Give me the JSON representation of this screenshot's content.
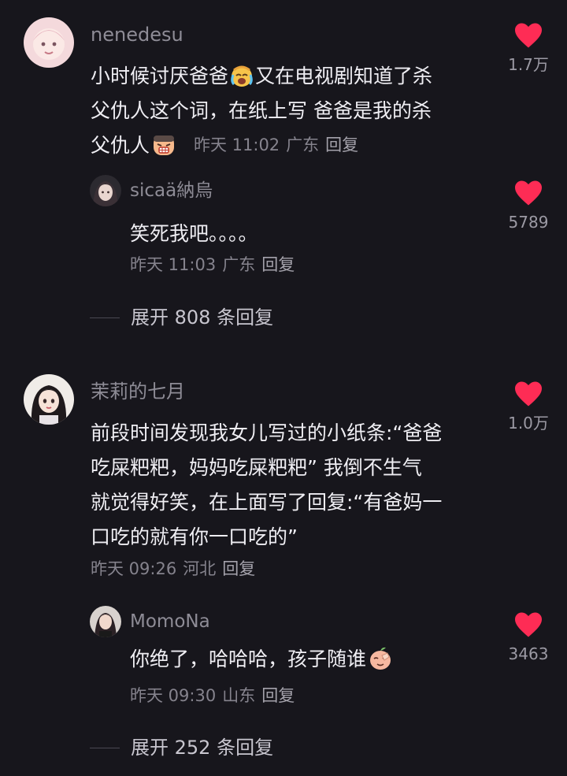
{
  "comments": [
    {
      "username": "nenedesu",
      "text_lines": [
        "小时候讨厌爸爸",
        "又在电视剧知道了杀",
        "父仇人这个词，在纸上写 爸爸是我的杀",
        "父仇人"
      ],
      "emoji": [
        "crying-face-emoji",
        "frustrated-face-emoji"
      ],
      "time": "昨天 11:02",
      "location": "广东",
      "reply_label": "回复",
      "likes": "1.7万",
      "reply": {
        "username": "sicaä納烏",
        "text": "笑死我吧。。。。",
        "time": "昨天 11:03",
        "location": "广东",
        "reply_label": "回复",
        "likes": "5789"
      },
      "expand_label": "展开 808 条回复"
    },
    {
      "username": "茉莉的七月",
      "text_lines": [
        "前段时间发现我女儿写过的小纸条:“爸爸",
        "吃屎粑粑，妈妈吃屎粑粑” 我倒不生气",
        "就觉得好笑，在上面写了回复:“有爸妈一",
        "口吃的就有你一口吃的”"
      ],
      "time": "昨天 09:26",
      "location": "河北",
      "reply_label": "回复",
      "likes": "1.0万",
      "reply": {
        "username": "MomoNa",
        "text": "你绝了，哈哈哈，孩子随谁",
        "emoji": "face-palm-peach-emoji",
        "time": "昨天 09:30",
        "location": "山东",
        "reply_label": "回复",
        "likes": "3463"
      },
      "expand_label": "展开 252 条回复"
    }
  ],
  "colors": {
    "background": "#17161c",
    "heart": "#fe2c55",
    "text": "#efeef3",
    "secondary": "#85838d"
  }
}
